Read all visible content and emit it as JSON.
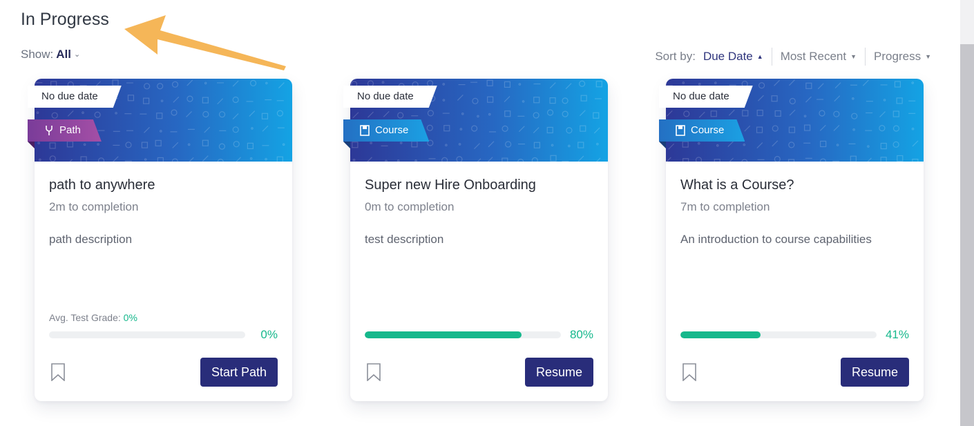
{
  "section": {
    "title": "In Progress"
  },
  "filter": {
    "label": "Show:",
    "value": "All"
  },
  "sort": {
    "label": "Sort by:",
    "options": [
      {
        "label": "Due Date",
        "active": true,
        "direction": "up"
      },
      {
        "label": "Most Recent",
        "active": false,
        "direction": "down"
      },
      {
        "label": "Progress",
        "active": false,
        "direction": "down"
      }
    ]
  },
  "colors": {
    "accent": "#292d7a",
    "progress": "#16b88c",
    "path_tag": "#8e449f",
    "course_tag": "#1e8ad6"
  },
  "cards": [
    {
      "due": "No due date",
      "type": "Path",
      "type_icon": "path-fork-icon",
      "title": "path to anywhere",
      "duration": "2m to completion",
      "description": "path description",
      "grade_label": "Avg. Test Grade:",
      "grade_value": "0%",
      "progress": 0,
      "progress_label": "0%",
      "action": "Start Path"
    },
    {
      "due": "No due date",
      "type": "Course",
      "type_icon": "course-book-icon",
      "title": "Super new Hire Onboarding",
      "duration": "0m to completion",
      "description": "test description",
      "progress": 80,
      "progress_label": "80%",
      "action": "Resume"
    },
    {
      "due": "No due date",
      "type": "Course",
      "type_icon": "course-book-icon",
      "title": "What is a Course?",
      "duration": "7m to completion",
      "description": "An introduction to course capabilities",
      "progress": 41,
      "progress_label": "41%",
      "action": "Resume"
    }
  ]
}
